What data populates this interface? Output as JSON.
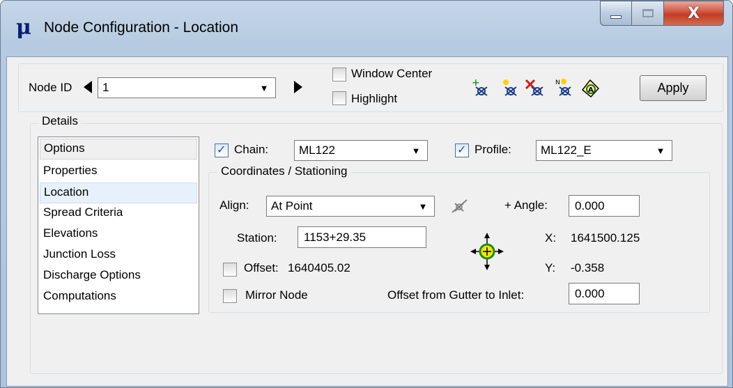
{
  "window": {
    "title": "Node Configuration - Location",
    "icon": "bentley-mu-icon",
    "controls": [
      "minimize",
      "maximize",
      "close"
    ]
  },
  "toolbar": {
    "node_id_label": "Node ID",
    "node_id_value": "1",
    "window_center_label": "Window Center",
    "window_center_checked": false,
    "highlight_label": "Highlight",
    "highlight_checked": false,
    "tool_icons": [
      "add-node-icon",
      "new-node-icon",
      "delete-node-icon",
      "rename-node-icon",
      "node-annotation-icon"
    ],
    "apply_label": "Apply"
  },
  "details": {
    "legend": "Details",
    "options_header": "Options",
    "options": [
      "Properties",
      "Location",
      "Spread Criteria",
      "Elevations",
      "Junction Loss",
      "Discharge Options",
      "Computations"
    ],
    "selected_option": "Location",
    "chain_label": "Chain:",
    "chain_checked": true,
    "chain_value": "ML122",
    "profile_label": "Profile:",
    "profile_checked": true,
    "profile_value": "ML122_E",
    "coordinates_legend": "Coordinates / Stationing",
    "align_label": "Align:",
    "align_value": "At Point",
    "angle_label": "+ Angle:",
    "angle_value": "0.000",
    "station_label": "Station:",
    "station_value": "1153+29.35",
    "x_label": "X:",
    "x_value": "1641500.125",
    "offset_label": "Offset:",
    "offset_checked": false,
    "offset_value": "1640405.02",
    "y_label": "Y:",
    "y_value": "-0.358",
    "mirror_label": "Mirror Node",
    "mirror_checked": false,
    "gutter_label": "Offset from Gutter to Inlet:",
    "gutter_value": "0.000"
  },
  "colors": {
    "title_bar": "#b9cde3",
    "close_button": "#c9462f",
    "selected_item": "#e7f1fb"
  }
}
